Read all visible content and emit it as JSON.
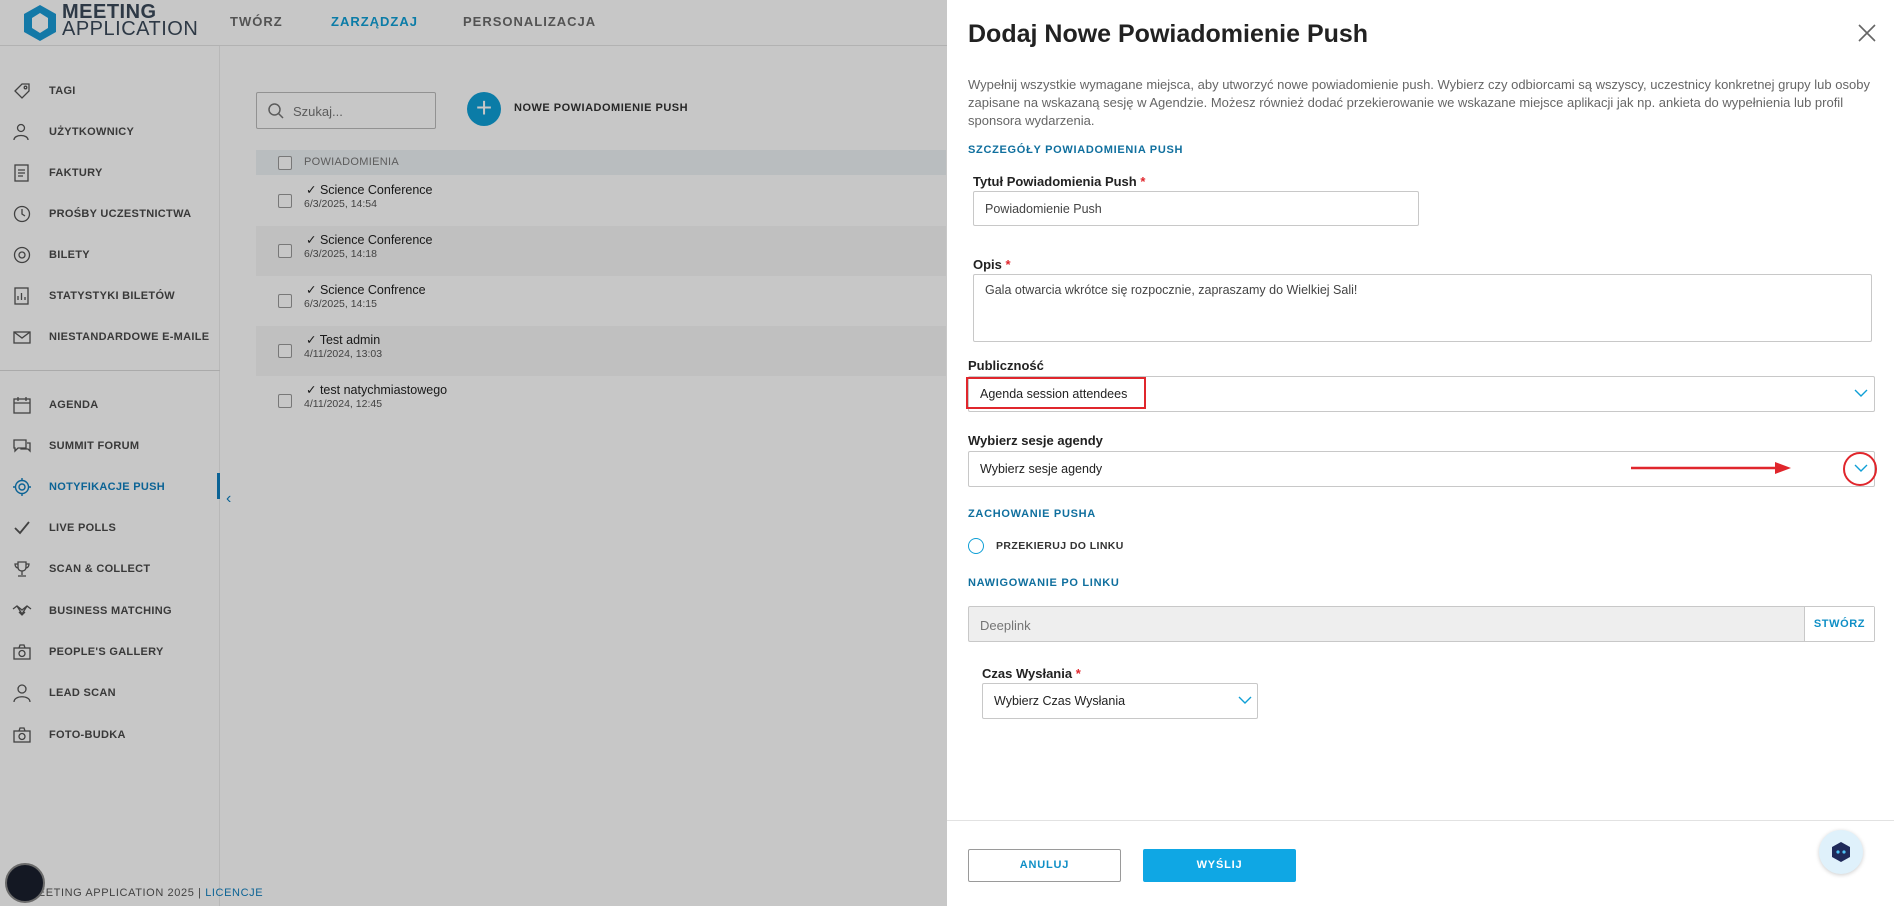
{
  "app": {
    "logo_line1": "MEETING",
    "logo_line2": "APPLICATION",
    "top_nav": [
      "TWÓRZ",
      "ZARZĄDZAJ",
      "PERSONALIZACJA"
    ],
    "active_nav": "ZARZĄDZAJ"
  },
  "sidebar": {
    "items": [
      {
        "label": "TAGI",
        "icon": "tag-icon"
      },
      {
        "label": "UŻYTKOWNICY",
        "icon": "user-icon"
      },
      {
        "label": "FAKTURY",
        "icon": "invoice-icon"
      },
      {
        "label": "PROŚBY UCZESTNICTWA",
        "icon": "clock-icon"
      },
      {
        "label": "BILETY",
        "icon": "ticket-icon"
      },
      {
        "label": "STATYSTYKI BILETÓW",
        "icon": "stats-icon"
      },
      {
        "label": "NIESTANDARDOWE E-MAILE",
        "icon": "mail-icon"
      },
      {
        "label": "AGENDA",
        "icon": "calendar-icon"
      },
      {
        "label": "SUMMIT FORUM",
        "icon": "chat-icon"
      },
      {
        "label": "NOTYFIKACJE PUSH",
        "icon": "push-icon"
      },
      {
        "label": "LIVE POLLS",
        "icon": "check-icon"
      },
      {
        "label": "SCAN & COLLECT",
        "icon": "trophy-icon"
      },
      {
        "label": "BUSINESS MATCHING",
        "icon": "handshake-icon"
      },
      {
        "label": "PEOPLE'S GALLERY",
        "icon": "camera-icon"
      },
      {
        "label": "LEAD SCAN",
        "icon": "person-icon"
      },
      {
        "label": "FOTO-BUDKA",
        "icon": "camera-icon"
      }
    ],
    "active_item": "NOTYFIKACJE PUSH"
  },
  "footer": {
    "text": "MEETING APPLICATION 2025 |",
    "link": "LICENCJE"
  },
  "list": {
    "search_placeholder": "Szukaj...",
    "new_button_label": "NOWE POWIADOMIENIE PUSH",
    "column_header": "POWIADOMIENIA",
    "rows": [
      {
        "title": "✓ Science Conference",
        "date": "6/3/2025, 14:54"
      },
      {
        "title": "✓ Science Conference",
        "date": "6/3/2025, 14:18"
      },
      {
        "title": "✓ Science Confrence",
        "date": "6/3/2025, 14:15"
      },
      {
        "title": "✓ Test admin",
        "date": "4/11/2024, 13:03"
      },
      {
        "title": "✓ test natychmiastowego",
        "date": "4/11/2024, 12:45"
      }
    ]
  },
  "panel": {
    "title": "Dodaj Nowe Powiadomienie Push",
    "description": "Wypełnij wszystkie wymagane miejsca, aby utworzyć nowe powiadomienie push. Wybierz czy odbiorcami są wszyscy, uczestnicy konkretnej grupy lub osoby zapisane na wskazaną sesję w Agendzie. Możesz również dodać przekierowanie we wskazane miejsce aplikacji jak np. ankieta do wypełnienia lub profil sponsora wydarzenia.",
    "section_details": "SZCZEGÓŁY POWIADOMIENIA PUSH",
    "title_label": "Tytuł Powiadomienia Push",
    "title_value": "Powiadomienie Push",
    "desc_label": "Opis",
    "desc_value": "Gala otwarcia wkrótce się rozpocznie, zapraszamy do Wielkiej Sali!",
    "audience_label": "Publiczność",
    "audience_value": "Agenda session attendees",
    "sessions_label": "Wybierz sesje agendy",
    "sessions_value": "Wybierz sesje agendy",
    "section_behavior": "ZACHOWANIE PUSHA",
    "redirect_label": "PRZEKIERUJ DO LINKU",
    "section_nav": "NAWIGOWANIE PO LINKU",
    "deeplink_placeholder": "Deeplink",
    "create_label": "STWÓRZ",
    "send_time_label": "Czas Wysłania",
    "send_time_value": "Wybierz Czas Wysłania",
    "required_mark": "*",
    "cancel_label": "ANULUJ",
    "send_label": "WYŚLIJ"
  },
  "colors": {
    "accent": "#0f9fd6",
    "highlight": "#e0262c"
  }
}
